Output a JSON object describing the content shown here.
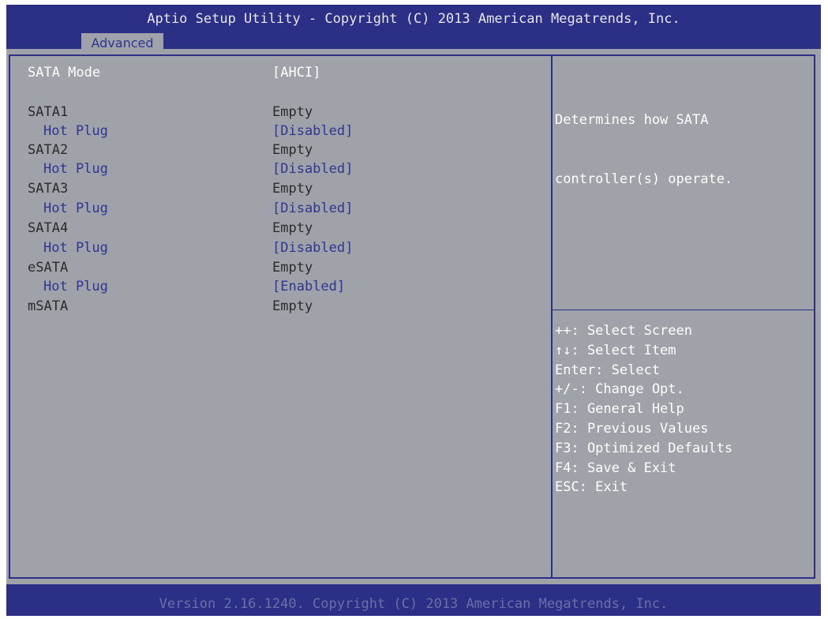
{
  "header": {
    "title": "Aptio Setup Utility - Copyright (C) 2013 American Megatrends, Inc.",
    "tabs": [
      {
        "label": "Advanced"
      }
    ]
  },
  "settings": [
    {
      "label": "SATA Mode",
      "value": "[AHCI]"
    },
    {
      "label": "SATA1",
      "value": "Empty"
    },
    {
      "label": "Hot Plug",
      "value": "[Disabled]"
    },
    {
      "label": "SATA2",
      "value": "Empty"
    },
    {
      "label": "Hot Plug",
      "value": "[Disabled]"
    },
    {
      "label": "SATA3",
      "value": "Empty"
    },
    {
      "label": "Hot Plug",
      "value": "[Disabled]"
    },
    {
      "label": "SATA4",
      "value": "Empty"
    },
    {
      "label": "Hot Plug",
      "value": "[Disabled]"
    },
    {
      "label": "eSATA",
      "value": "Empty"
    },
    {
      "label": "Hot Plug",
      "value": "[Enabled]"
    },
    {
      "label": "mSATA",
      "value": "Empty"
    }
  ],
  "help": {
    "lines": [
      "Determines how SATA",
      "controller(s) operate."
    ]
  },
  "keys": [
    "++: Select Screen",
    "↑↓: Select Item",
    "Enter: Select",
    "+/-: Change Opt.",
    "F1: General Help",
    "F2: Previous Values",
    "F3: Optimized Defaults",
    "F4: Save & Exit",
    "ESC: Exit"
  ],
  "footer": {
    "text": "Version 2.16.1240. Copyright (C) 2013 American Megatrends, Inc."
  },
  "colors": {
    "header_blue": "#2b2f86",
    "panel_gray": "#a0a2aa",
    "option_blue": "#2f3591",
    "info_text": "#2b2b2b",
    "highlight_text": "#ffffff"
  }
}
